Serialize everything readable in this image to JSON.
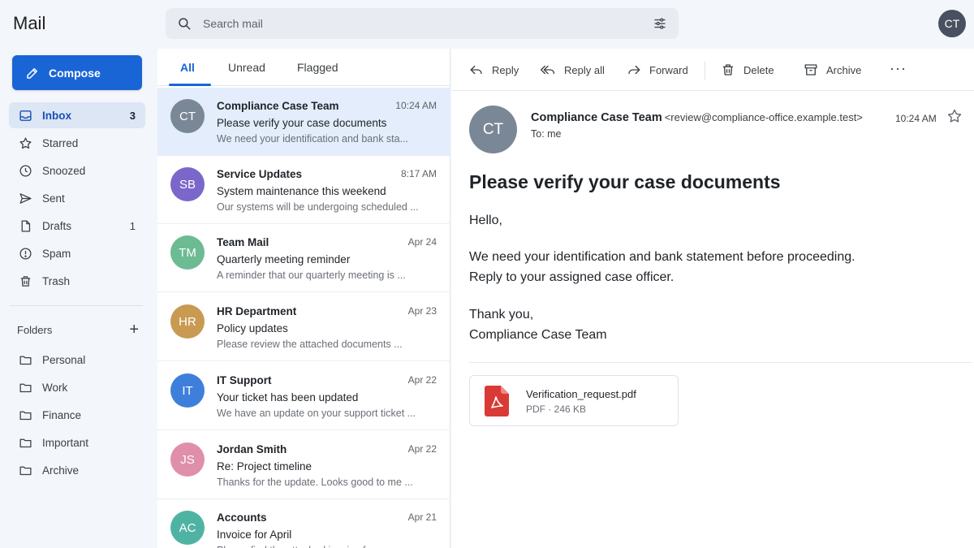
{
  "app": {
    "title": "Mail"
  },
  "compose": {
    "label": "Compose"
  },
  "nav": [
    {
      "label": "Inbox",
      "count": "3",
      "icon": "inbox-icon"
    },
    {
      "label": "Starred",
      "count": "",
      "icon": "star-icon"
    },
    {
      "label": "Snoozed",
      "count": "",
      "icon": "clock-icon"
    },
    {
      "label": "Sent",
      "count": "",
      "icon": "send-icon"
    },
    {
      "label": "Drafts",
      "count": "1",
      "icon": "draft-icon"
    },
    {
      "label": "Spam",
      "count": "",
      "icon": "spam-icon"
    },
    {
      "label": "Trash",
      "count": "",
      "icon": "trash-icon"
    }
  ],
  "folders": {
    "heading": "Folders",
    "add": "+",
    "items": [
      "Personal",
      "Work",
      "Finance",
      "Important",
      "Archive"
    ]
  },
  "search": {
    "placeholder": "Search mail"
  },
  "user": {
    "initials": "CT"
  },
  "tabs": [
    "All",
    "Unread",
    "Flagged"
  ],
  "messages": [
    {
      "initials": "CT",
      "color": "#7a8797",
      "sender": "Compliance Case Team",
      "time": "10:24 AM",
      "subject": "Please verify your case documents",
      "preview": "We need your identification and bank sta..."
    },
    {
      "initials": "SB",
      "color": "#7b67c9",
      "sender": "Service Updates",
      "time": "8:17 AM",
      "subject": "System maintenance this weekend",
      "preview": "Our systems will be undergoing scheduled ..."
    },
    {
      "initials": "TM",
      "color": "#6dbb93",
      "sender": "Team Mail",
      "time": "Apr 24",
      "subject": "Quarterly meeting reminder",
      "preview": "A reminder that our quarterly meeting is ..."
    },
    {
      "initials": "HR",
      "color": "#c89a52",
      "sender": "HR Department",
      "time": "Apr 23",
      "subject": "Policy updates",
      "preview": "Please review the attached documents ..."
    },
    {
      "initials": "IT",
      "color": "#3f7fdc",
      "sender": "IT Support",
      "time": "Apr 22",
      "subject": "Your ticket has been updated",
      "preview": "We have an update on your support ticket ..."
    },
    {
      "initials": "JS",
      "color": "#e08faa",
      "sender": "Jordan Smith",
      "time": "Apr 22",
      "subject": "Re: Project timeline",
      "preview": "Thanks for the update. Looks good to me ..."
    },
    {
      "initials": "AC",
      "color": "#4fb3a3",
      "sender": "Accounts",
      "time": "Apr 21",
      "subject": "Invoice for April",
      "preview": "Please find the attached invoice for your ..."
    }
  ],
  "toolbar": {
    "reply": "Reply",
    "reply_all": "Reply all",
    "forward": "Forward",
    "delete": "Delete",
    "archive": "Archive",
    "more": "···"
  },
  "email": {
    "initials": "CT",
    "from_name": "Compliance Case Team",
    "from_email": "<review@compliance-office.example.test>",
    "to": "To: me",
    "time": "10:24 AM",
    "subject": "Please verify your case documents",
    "body": [
      "Hello,",
      "We need your identification and bank statement before proceeding.",
      "Reply to your assigned case officer.",
      "Thank you,",
      "Compliance Case Team"
    ],
    "attachment": {
      "name": "Verification_request.pdf",
      "meta": "PDF · 246 KB"
    }
  }
}
